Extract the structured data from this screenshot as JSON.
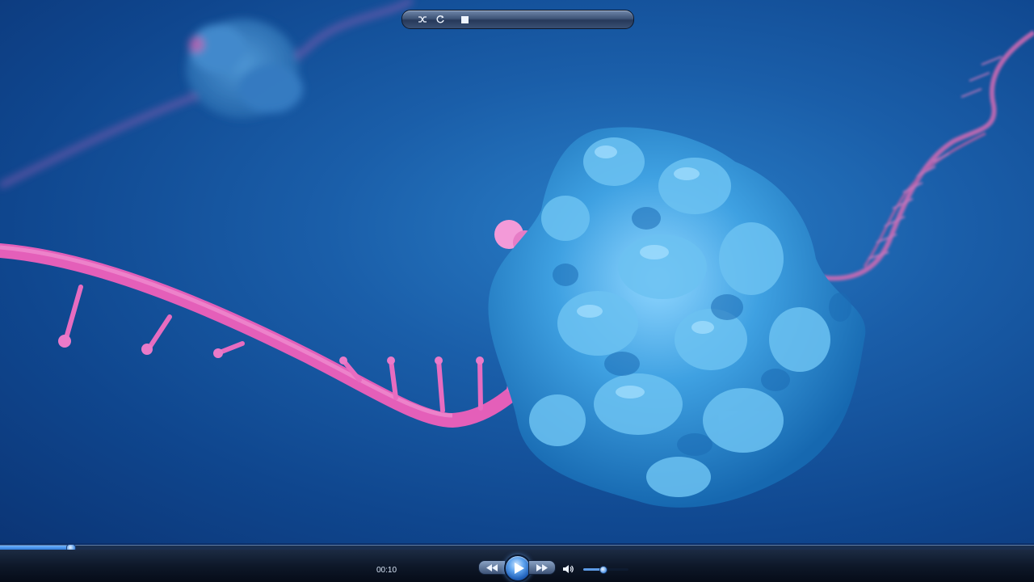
{
  "player": {
    "time_elapsed": "00:10",
    "progress_fraction": 0.068,
    "volume_fraction": 0.42,
    "accent_color": "#3f8ae0"
  },
  "controls": {
    "shuffle_icon": "shuffle-icon",
    "repeat_icon": "repeat-icon",
    "stop_icon": "stop-icon",
    "rewind_icon": "rewind-icon",
    "play_icon": "play-icon",
    "fast_forward_icon": "fast-forward-icon",
    "volume_icon": "speaker-icon"
  },
  "scene_colors": {
    "ribosome": "#3aa0e0",
    "mrna": "#e85bb8",
    "background": "#1a5ea9"
  }
}
